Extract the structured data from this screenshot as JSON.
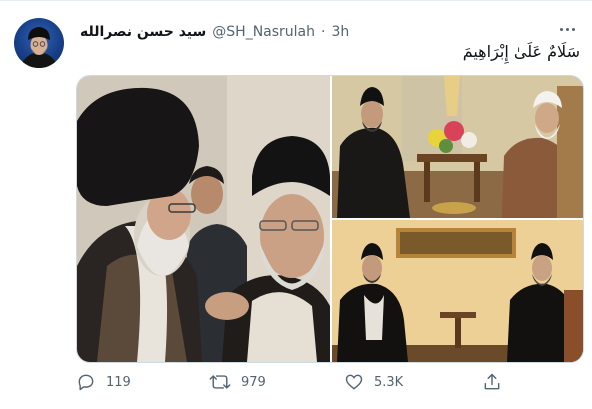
{
  "tweet": {
    "author": {
      "display_name": "سید حسن نصرالله",
      "handle": "@SH_Nasrulah",
      "separator": "·",
      "time": "3h"
    },
    "text": "سَلَامٌ عَلَىٰ إِبْرَاهِيمَ",
    "media": {
      "count": 3,
      "photos": [
        "photo-left-large",
        "photo-top-right",
        "photo-bottom-right"
      ]
    },
    "actions": {
      "reply": {
        "icon": "reply-icon",
        "count": "119"
      },
      "retweet": {
        "icon": "retweet-icon",
        "count": "979"
      },
      "like": {
        "icon": "heart-icon",
        "count": "5.3K"
      },
      "share": {
        "icon": "share-icon"
      }
    }
  },
  "colors": {
    "text_primary": "#0f1419",
    "text_secondary": "#536471",
    "border": "#cfd9de",
    "background": "#ffffff"
  }
}
